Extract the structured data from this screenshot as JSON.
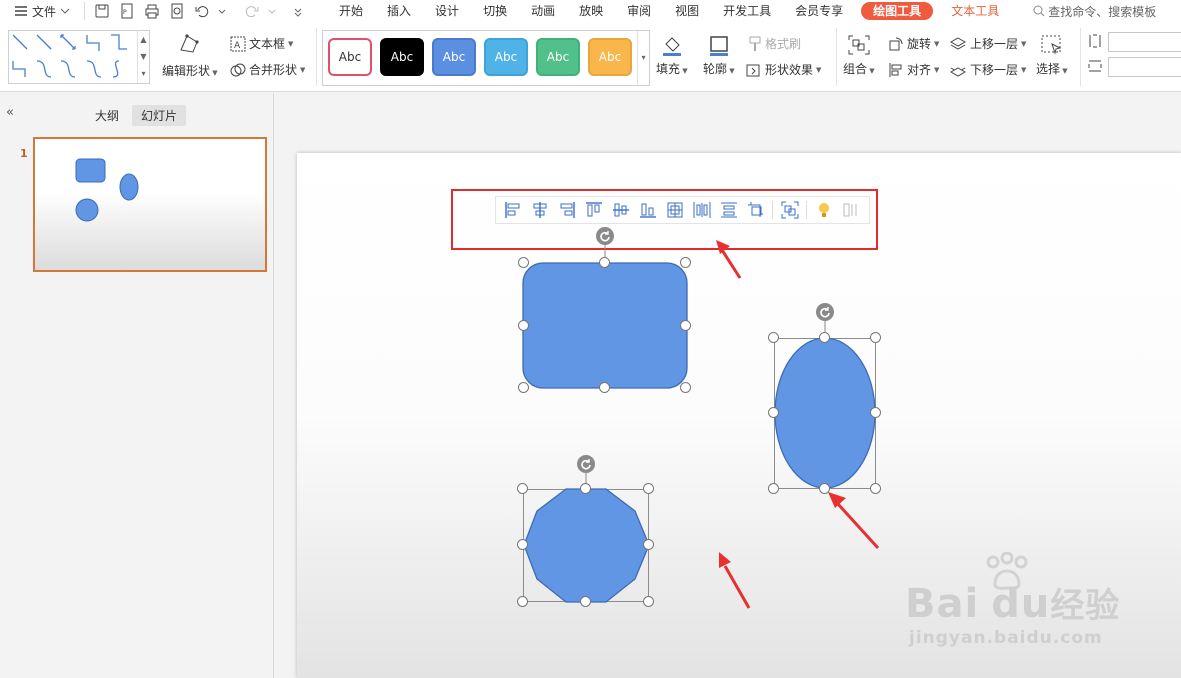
{
  "menubar": {
    "file_label": "文件",
    "tabs": [
      "开始",
      "插入",
      "设计",
      "切换",
      "动画",
      "放映",
      "审阅",
      "视图",
      "开发工具",
      "会员专享"
    ],
    "drawing_tools_tab": "绘图工具",
    "text_tools_tab": "文本工具",
    "search_placeholder": "查找命令、搜索模板"
  },
  "ribbon": {
    "edit_shape": "编辑形状",
    "text_box": "文本框",
    "merge_shape": "合并形状",
    "style_label": "Abc",
    "format_painter": "格式刷",
    "fill": "填充",
    "outline": "轮廓",
    "shape_effects": "形状效果",
    "rotate": "旋转",
    "bring_forward": "上移一层",
    "group": "组合",
    "align": "对齐",
    "send_backward": "下移一层",
    "select": "选择"
  },
  "style_swatches": [
    {
      "bg": "#ffffff",
      "border": "#e0506a",
      "fg": "#333333"
    },
    {
      "bg": "#000000",
      "border": "#000000",
      "fg": "#ffffff"
    },
    {
      "bg": "#5b8fe0",
      "border": "#4a7bd0",
      "fg": "#ffffff"
    },
    {
      "bg": "#4fb3e8",
      "border": "#3fa3d8",
      "fg": "#ffffff"
    },
    {
      "bg": "#52c08a",
      "border": "#42b07a",
      "fg": "#ffffff"
    },
    {
      "bg": "#f8b64c",
      "border": "#e8a63c",
      "fg": "#ffffff"
    }
  ],
  "left_panel": {
    "outline_tab": "大纲",
    "slides_tab": "幻灯片",
    "slide_number": "1"
  },
  "align_toolbar_icons": [
    "align-left-icon",
    "align-center-horizontal-icon",
    "align-right-icon",
    "align-top-icon",
    "align-middle-vertical-icon",
    "align-bottom-icon",
    "center-on-page-icon",
    "distribute-horizontal-icon",
    "distribute-vertical-icon",
    "fit-to-slide-icon",
    "group-objects-icon",
    "smart-tip-bulb-icon",
    "more-options-icon"
  ],
  "colors": {
    "shape_fill": "#6096e4",
    "shape_stroke": "#3e6bb3",
    "accent_red": "#e02c2c",
    "tab_active": "#f05a3e"
  },
  "watermark": {
    "brand": "Bai",
    "brand_suffix": "du",
    "brand_cn": "经验",
    "url": "jingyan.baidu.com"
  }
}
